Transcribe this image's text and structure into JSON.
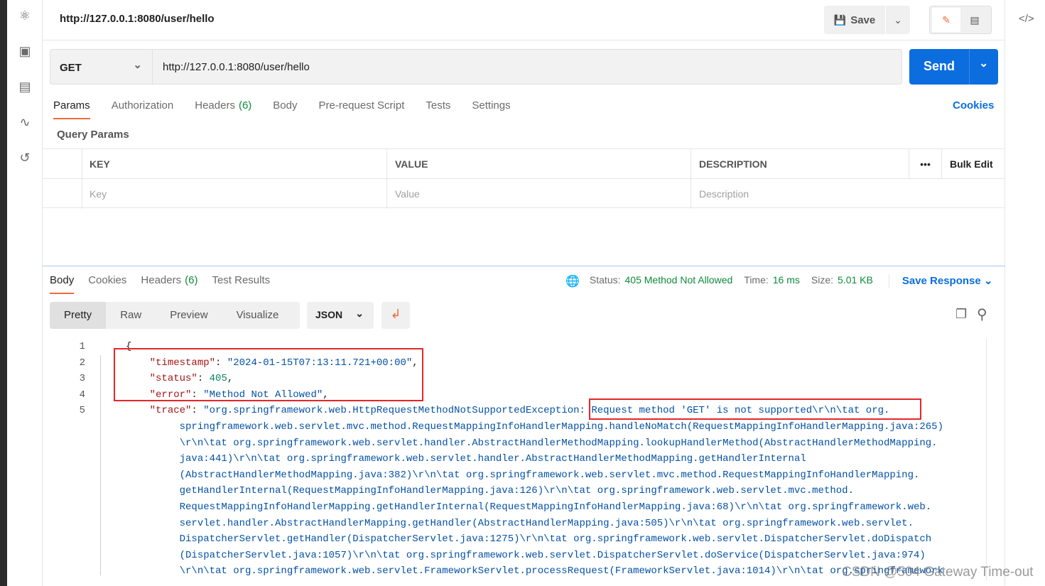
{
  "sidebar": {
    "icons": [
      "apis-icon",
      "environments-icon",
      "mock-servers-icon",
      "monitors-icon",
      "history-icon"
    ]
  },
  "header": {
    "title": "http://127.0.0.1:8080/user/hello",
    "save_label": "Save"
  },
  "request": {
    "method": "GET",
    "url": "http://127.0.0.1:8080/user/hello",
    "send_label": "Send"
  },
  "request_tabs": [
    {
      "label": "Params"
    },
    {
      "label": "Authorization"
    },
    {
      "label": "Headers",
      "count": "(6)"
    },
    {
      "label": "Body"
    },
    {
      "label": "Pre-request Script"
    },
    {
      "label": "Tests"
    },
    {
      "label": "Settings"
    }
  ],
  "cookies_link": "Cookies",
  "query_params": {
    "title": "Query Params",
    "headers": [
      "KEY",
      "VALUE",
      "DESCRIPTION"
    ],
    "bulk_edit": "Bulk Edit",
    "placeholders": [
      "Key",
      "Value",
      "Description"
    ]
  },
  "response_tabs": [
    {
      "label": "Body"
    },
    {
      "label": "Cookies"
    },
    {
      "label": "Headers",
      "count": "(6)"
    },
    {
      "label": "Test Results"
    }
  ],
  "status": {
    "status_label": "Status:",
    "status_value": "405 Method Not Allowed",
    "time_label": "Time:",
    "time_value": "16 ms",
    "size_label": "Size:",
    "size_value": "5.01 KB",
    "save_response": "Save Response"
  },
  "view_modes": [
    "Pretty",
    "Raw",
    "Preview",
    "Visualize"
  ],
  "format": "JSON",
  "code_lines": [
    {
      "n": "1",
      "parts": [
        [
          "p",
          "{"
        ]
      ]
    },
    {
      "n": "2",
      "parts": [
        [
          "p",
          "    "
        ],
        [
          "k",
          "\"timestamp\""
        ],
        [
          "p",
          ": "
        ],
        [
          "s",
          "\"2024-01-15T07:13:11.721+00:00\""
        ],
        [
          "p",
          ","
        ]
      ]
    },
    {
      "n": "3",
      "parts": [
        [
          "p",
          "    "
        ],
        [
          "k",
          "\"status\""
        ],
        [
          "p",
          ": "
        ],
        [
          "n",
          "405"
        ],
        [
          "p",
          ","
        ]
      ]
    },
    {
      "n": "4",
      "parts": [
        [
          "p",
          "    "
        ],
        [
          "k",
          "\"error\""
        ],
        [
          "p",
          ": "
        ],
        [
          "s",
          "\"Method Not Allowed\""
        ],
        [
          "p",
          ","
        ]
      ]
    },
    {
      "n": "5",
      "parts": [
        [
          "p",
          "    "
        ],
        [
          "k",
          "\"trace\""
        ],
        [
          "p",
          ": "
        ],
        [
          "s",
          "\"org.springframework.web.HttpRequestMethodNotSupportedException: Request method 'GET' is not supported\\r\\n\\tat org."
        ]
      ]
    },
    {
      "n": "",
      "parts": [
        [
          "s",
          "         springframework.web.servlet.mvc.method.RequestMappingInfoHandlerMapping.handleNoMatch(RequestMappingInfoHandlerMapping.java:265)"
        ]
      ]
    },
    {
      "n": "",
      "parts": [
        [
          "s",
          "         \\r\\n\\tat org.springframework.web.servlet.handler.AbstractHandlerMethodMapping.lookupHandlerMethod(AbstractHandlerMethodMapping."
        ]
      ]
    },
    {
      "n": "",
      "parts": [
        [
          "s",
          "         java:441)\\r\\n\\tat org.springframework.web.servlet.handler.AbstractHandlerMethodMapping.getHandlerInternal"
        ]
      ]
    },
    {
      "n": "",
      "parts": [
        [
          "s",
          "         (AbstractHandlerMethodMapping.java:382)\\r\\n\\tat org.springframework.web.servlet.mvc.method.RequestMappingInfoHandlerMapping."
        ]
      ]
    },
    {
      "n": "",
      "parts": [
        [
          "s",
          "         getHandlerInternal(RequestMappingInfoHandlerMapping.java:126)\\r\\n\\tat org.springframework.web.servlet.mvc.method."
        ]
      ]
    },
    {
      "n": "",
      "parts": [
        [
          "s",
          "         RequestMappingInfoHandlerMapping.getHandlerInternal(RequestMappingInfoHandlerMapping.java:68)\\r\\n\\tat org.springframework.web."
        ]
      ]
    },
    {
      "n": "",
      "parts": [
        [
          "s",
          "         servlet.handler.AbstractHandlerMapping.getHandler(AbstractHandlerMapping.java:505)\\r\\n\\tat org.springframework.web.servlet."
        ]
      ]
    },
    {
      "n": "",
      "parts": [
        [
          "s",
          "         DispatcherServlet.getHandler(DispatcherServlet.java:1275)\\r\\n\\tat org.springframework.web.servlet.DispatcherServlet.doDispatch"
        ]
      ]
    },
    {
      "n": "",
      "parts": [
        [
          "s",
          "         (DispatcherServlet.java:1057)\\r\\n\\tat org.springframework.web.servlet.DispatcherServlet.doService(DispatcherServlet.java:974)"
        ]
      ]
    },
    {
      "n": "",
      "parts": [
        [
          "s",
          "         \\r\\n\\tat org.springframework.web.servlet.FrameworkServlet.processRequest(FrameworkServlet.java:1014)\\r\\n\\tat org.springframework"
        ]
      ]
    }
  ],
  "watermark": "CSDN @504 Gateway Time-out",
  "colors": {
    "accent": "#f26b3a",
    "send": "#0c6ddf",
    "status_green": "#0f8a3a",
    "link": "#0c6ddf",
    "highlight_box": "#e5262a"
  }
}
